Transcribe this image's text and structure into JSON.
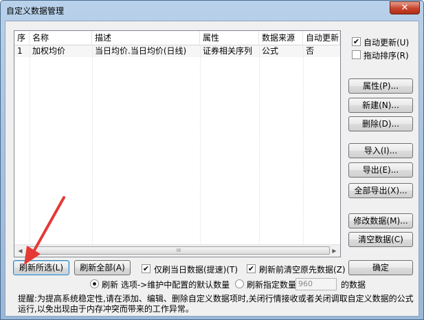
{
  "window": {
    "title": "自定义数据管理",
    "close_glyph": "✕"
  },
  "list": {
    "columns": [
      "序",
      "名称",
      "描述",
      "属性",
      "数据来源",
      "自动更新"
    ],
    "rows": [
      {
        "idx": "1",
        "name": "加权均价",
        "desc": "当日均价.当日均价(日线)",
        "attr": "证券相关序列",
        "source": "公式",
        "auto": "否"
      }
    ],
    "scroll_left": "◀",
    "scroll_right": "▶",
    "thumb_grip": "III"
  },
  "side": {
    "auto_update_label": "自动更新(U)",
    "auto_update_checked": true,
    "drag_sort_label": "拖动排序(R)",
    "drag_sort_checked": false,
    "buttons": {
      "properties": "属性(P)...",
      "new": "新建(N)...",
      "delete": "删除(D)...",
      "import": "导入(I)...",
      "export": "导出(E)...",
      "export_all": "全部导出(X)...",
      "modify_data": "修改数据(M)...",
      "clear_data": "清空数据(C)"
    }
  },
  "bottom": {
    "refresh_selected": "刷新所选(L)",
    "refresh_all": "刷新全部(A)",
    "only_today_label": "仅刷当日数据(提速)(T)",
    "only_today_checked": true,
    "clear_before_label": "刷新前清空原先数据(Z)",
    "clear_before_checked": true,
    "ok": "确定",
    "radio_default_label": "刷新 选项->维护中配置的默认数量",
    "radio_default_selected": true,
    "radio_specified_label": "刷新指定数量",
    "specified_value": "960",
    "data_suffix": "的数据",
    "hint": "提醒:为提高系统稳定性,请在添加、编辑、删除自定义数据项时,关闭行情接收或者关闭调取自定义数据的公式运行,以免出现由于内存冲突而带来的工作异常。"
  },
  "checkmark": "✔"
}
